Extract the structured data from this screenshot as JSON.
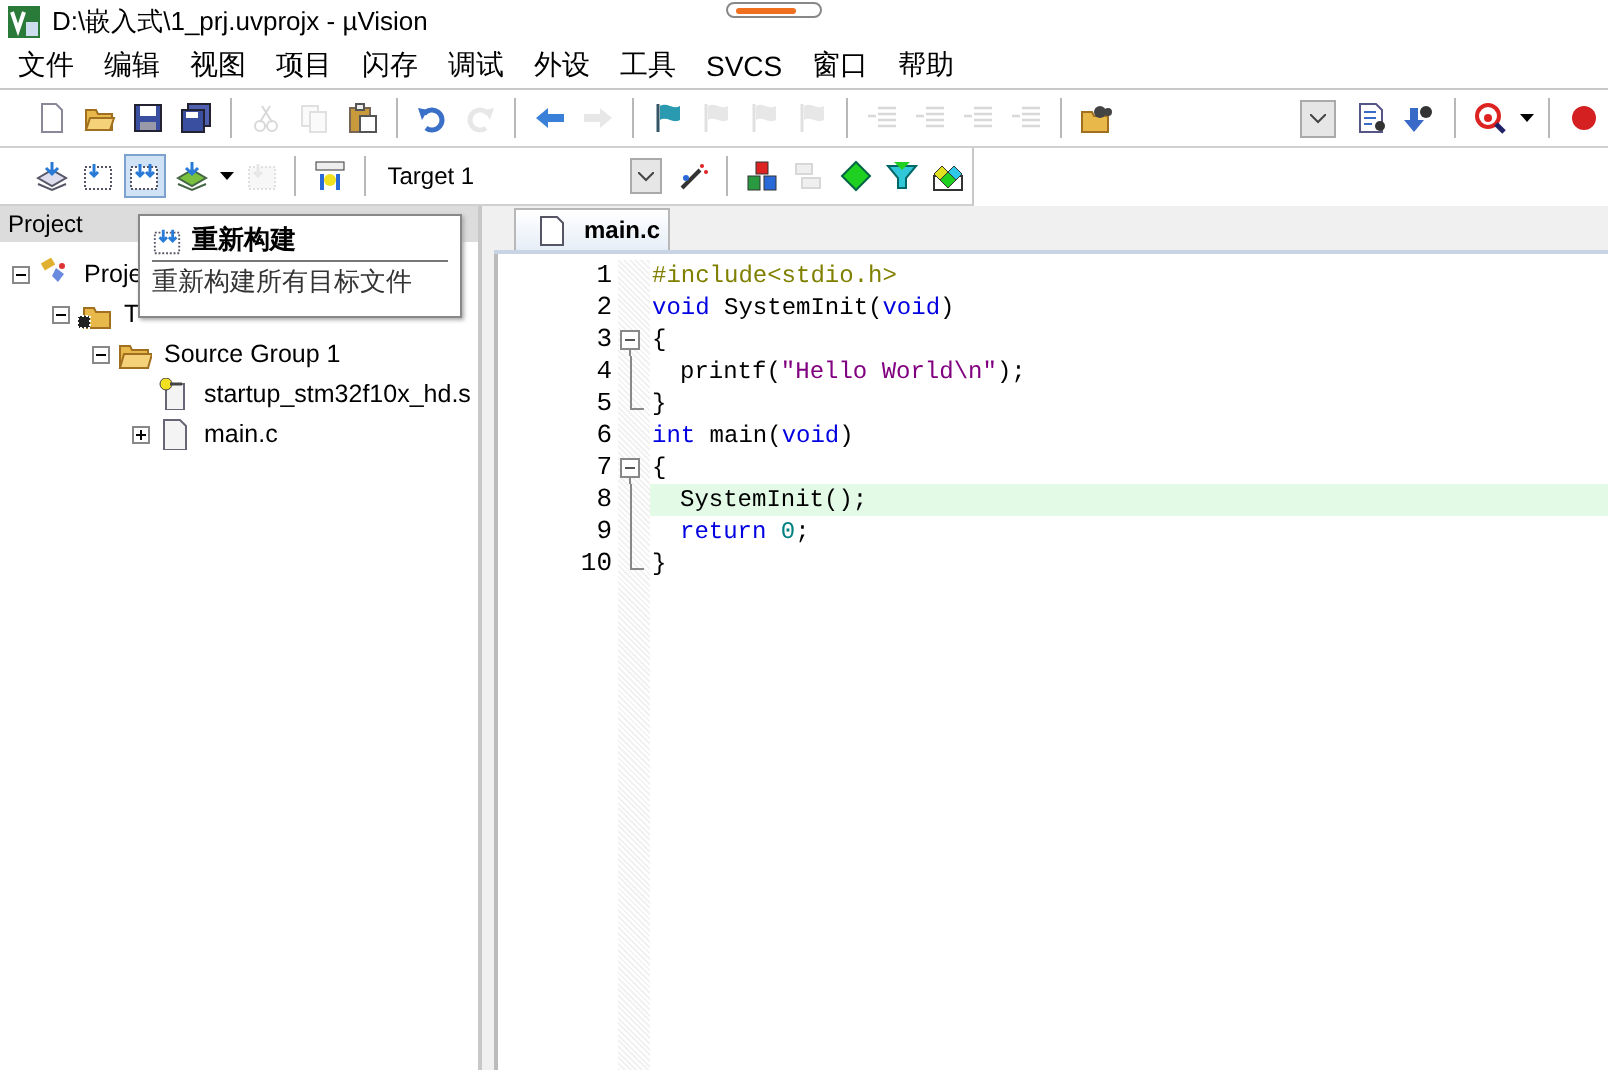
{
  "window": {
    "title": "D:\\嵌入式\\1_prj.uvprojx - µVision"
  },
  "menu": [
    {
      "label": "文件"
    },
    {
      "label": "编辑"
    },
    {
      "label": "视图"
    },
    {
      "label": "项目"
    },
    {
      "label": "闪存"
    },
    {
      "label": "调试"
    },
    {
      "label": "外设"
    },
    {
      "label": "工具"
    },
    {
      "label": "SVCS"
    },
    {
      "label": "窗口"
    },
    {
      "label": "帮助"
    }
  ],
  "toolbar_file": {
    "items": [
      {
        "kind": "new",
        "disabled": false
      },
      {
        "kind": "open",
        "disabled": false
      },
      {
        "kind": "save",
        "disabled": false
      },
      {
        "kind": "save-all",
        "disabled": false
      },
      {
        "kind": "separator"
      },
      {
        "kind": "cut",
        "disabled": true
      },
      {
        "kind": "copy",
        "disabled": true
      },
      {
        "kind": "paste",
        "disabled": false
      },
      {
        "kind": "separator"
      },
      {
        "kind": "undo",
        "disabled": false
      },
      {
        "kind": "redo",
        "disabled": true
      },
      {
        "kind": "separator"
      },
      {
        "kind": "back",
        "disabled": false
      },
      {
        "kind": "forward",
        "disabled": true
      },
      {
        "kind": "separator"
      },
      {
        "kind": "bookmark",
        "disabled": false
      },
      {
        "kind": "bookmark-prev",
        "disabled": true
      },
      {
        "kind": "bookmark-next",
        "disabled": true
      },
      {
        "kind": "bookmark-clear",
        "disabled": true
      },
      {
        "kind": "separator"
      },
      {
        "kind": "indent",
        "disabled": true
      },
      {
        "kind": "unindent",
        "disabled": true
      },
      {
        "kind": "comment",
        "disabled": true
      },
      {
        "kind": "uncomment",
        "disabled": true
      },
      {
        "kind": "separator"
      },
      {
        "kind": "find-files",
        "disabled": false
      }
    ],
    "right_items": [
      {
        "kind": "combo"
      },
      {
        "kind": "find-doc",
        "disabled": false
      },
      {
        "kind": "inc-find",
        "disabled": false
      },
      {
        "kind": "separator"
      },
      {
        "kind": "debug",
        "disabled": false
      },
      {
        "kind": "caret"
      },
      {
        "kind": "separator"
      },
      {
        "kind": "breakpoint",
        "disabled": false
      }
    ]
  },
  "toolbar_build": {
    "items": [
      {
        "kind": "translate",
        "disabled": false,
        "hovered": false
      },
      {
        "kind": "build",
        "disabled": false,
        "hovered": false
      },
      {
        "kind": "rebuild",
        "disabled": false,
        "hovered": true
      },
      {
        "kind": "batch",
        "disabled": false,
        "hovered": false
      },
      {
        "kind": "caret"
      },
      {
        "kind": "stop",
        "disabled": true,
        "hovered": false
      },
      {
        "kind": "separator"
      },
      {
        "kind": "load",
        "disabled": false,
        "hovered": false
      },
      {
        "kind": "separator"
      },
      {
        "kind": "select",
        "value": "Target 1"
      },
      {
        "kind": "wizard",
        "disabled": false,
        "hovered": false
      },
      {
        "kind": "separator"
      },
      {
        "kind": "manage",
        "disabled": false,
        "hovered": false
      },
      {
        "kind": "pack",
        "disabled": true,
        "hovered": false
      },
      {
        "kind": "diamond",
        "disabled": false,
        "hovered": false
      },
      {
        "kind": "filter",
        "disabled": false,
        "hovered": false
      },
      {
        "kind": "diamonds",
        "disabled": false,
        "hovered": false
      }
    ]
  },
  "project_panel": {
    "title": "Project",
    "tree": [
      {
        "label": "Proje",
        "kind": "project",
        "expanded": true,
        "children": [
          {
            "label": "T",
            "kind": "target",
            "expanded": true,
            "children": [
              {
                "label": "Source Group 1",
                "kind": "group",
                "expanded": true,
                "children": [
                  {
                    "label": "startup_stm32f10x_hd.s",
                    "kind": "asm-file"
                  },
                  {
                    "label": "main.c",
                    "kind": "c-file",
                    "expanded": false
                  }
                ]
              }
            ]
          }
        ]
      }
    ]
  },
  "tooltip": {
    "title": "重新构建",
    "description": "重新构建所有目标文件"
  },
  "editor": {
    "tabs": [
      {
        "label": "main.c",
        "selected": true
      }
    ],
    "lines": [
      {
        "number": "1",
        "kind": "plain",
        "indented": false,
        "highlighted": false,
        "tokens": [
          {
            "kind": "preproc",
            "text": "#include<stdio.h>"
          }
        ]
      },
      {
        "number": "2",
        "kind": "plain",
        "indented": false,
        "highlighted": false,
        "tokens": [
          {
            "kind": "keyword",
            "text": "void"
          },
          {
            "kind": "plain",
            "text": " SystemInit("
          },
          {
            "kind": "keyword",
            "text": "void"
          },
          {
            "kind": "plain",
            "text": ")"
          }
        ]
      },
      {
        "number": "3",
        "kind": "fold-start",
        "indented": false,
        "highlighted": false,
        "tokens": [
          {
            "kind": "plain",
            "text": "{"
          }
        ]
      },
      {
        "number": "4",
        "kind": "fold-body",
        "indented": true,
        "highlighted": false,
        "tokens": [
          {
            "kind": "plain",
            "text": "printf("
          },
          {
            "kind": "string",
            "text": "\"Hello World\\n\""
          },
          {
            "kind": "plain",
            "text": ");"
          }
        ]
      },
      {
        "number": "5",
        "kind": "fold-end",
        "indented": false,
        "highlighted": false,
        "tokens": [
          {
            "kind": "plain",
            "text": "}"
          }
        ]
      },
      {
        "number": "6",
        "kind": "plain",
        "indented": false,
        "highlighted": false,
        "tokens": [
          {
            "kind": "keyword",
            "text": "int"
          },
          {
            "kind": "plain",
            "text": " main("
          },
          {
            "kind": "keyword",
            "text": "void"
          },
          {
            "kind": "plain",
            "text": ")"
          }
        ]
      },
      {
        "number": "7",
        "kind": "fold-start",
        "indented": false,
        "highlighted": false,
        "tokens": [
          {
            "kind": "plain",
            "text": "{"
          }
        ]
      },
      {
        "number": "8",
        "kind": "fold-body",
        "indented": true,
        "highlighted": true,
        "tokens": [
          {
            "kind": "plain",
            "text": "SystemInit();"
          }
        ]
      },
      {
        "number": "9",
        "kind": "fold-body",
        "indented": true,
        "highlighted": false,
        "tokens": [
          {
            "kind": "keyword",
            "text": "return "
          },
          {
            "kind": "number",
            "text": "0"
          },
          {
            "kind": "plain",
            "text": ";"
          }
        ]
      },
      {
        "number": "10",
        "kind": "fold-end",
        "indented": false,
        "highlighted": false,
        "tokens": [
          {
            "kind": "plain",
            "text": "}"
          }
        ]
      }
    ]
  }
}
